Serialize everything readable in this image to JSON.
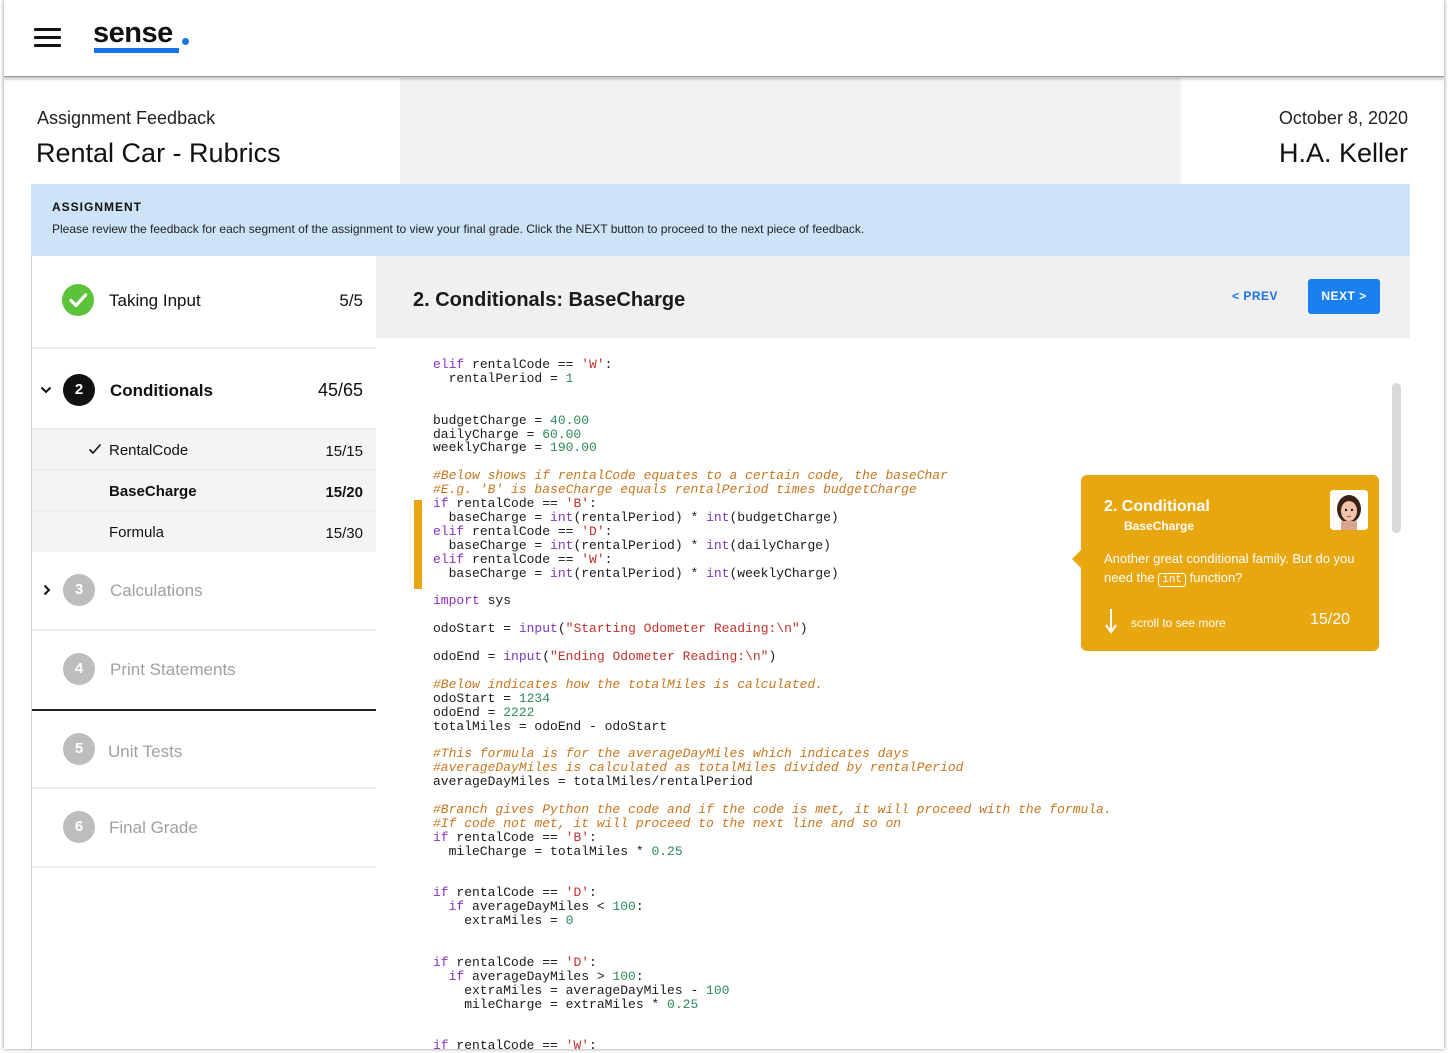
{
  "header": {
    "logo_text": "sense",
    "brand_color": "#1a73e8",
    "subtitle": "Assignment Feedback",
    "title": "Rental Car - Rubrics",
    "date": "October 8, 2020",
    "user_name": "H.A. Keller"
  },
  "banner": {
    "title": "ASSIGNMENT",
    "text": "Please review the feedback for each segment of the assignment to view your final grade. Click the NEXT button to proceed to the next piece of feedback."
  },
  "sidebar": {
    "steps": [
      {
        "number": "",
        "label": "Taking Input",
        "score": "5/5",
        "status": "complete"
      },
      {
        "number": "2",
        "label": "Conditionals",
        "score": "45/65",
        "status": "active"
      },
      {
        "number": "3",
        "label": "Calculations",
        "score": "",
        "status": "locked"
      },
      {
        "number": "4",
        "label": "Print Statements",
        "score": "",
        "status": "locked"
      },
      {
        "number": "5",
        "label": "Unit Tests",
        "score": "",
        "status": "locked"
      },
      {
        "number": "6",
        "label": "Final Grade",
        "score": "",
        "status": "locked"
      }
    ],
    "substeps": [
      {
        "label": "RentalCode",
        "score": "15/15",
        "checked": true
      },
      {
        "label": "BaseCharge",
        "score": "15/20",
        "selected": true
      },
      {
        "label": "Formula",
        "score": "15/30"
      }
    ]
  },
  "main": {
    "title": "2.  Conditionals:  BaseCharge",
    "prev_label": "< PREV",
    "next_label": "NEXT >"
  },
  "tooltip": {
    "title": "2. Conditional",
    "subtitle": "BaseCharge",
    "body_before": "Another great conditional family. But do you need the ",
    "body_code": "int",
    "body_after": " function?",
    "scroll_label": "scroll to see more",
    "score": "15/20",
    "color": "#e9a70f"
  }
}
